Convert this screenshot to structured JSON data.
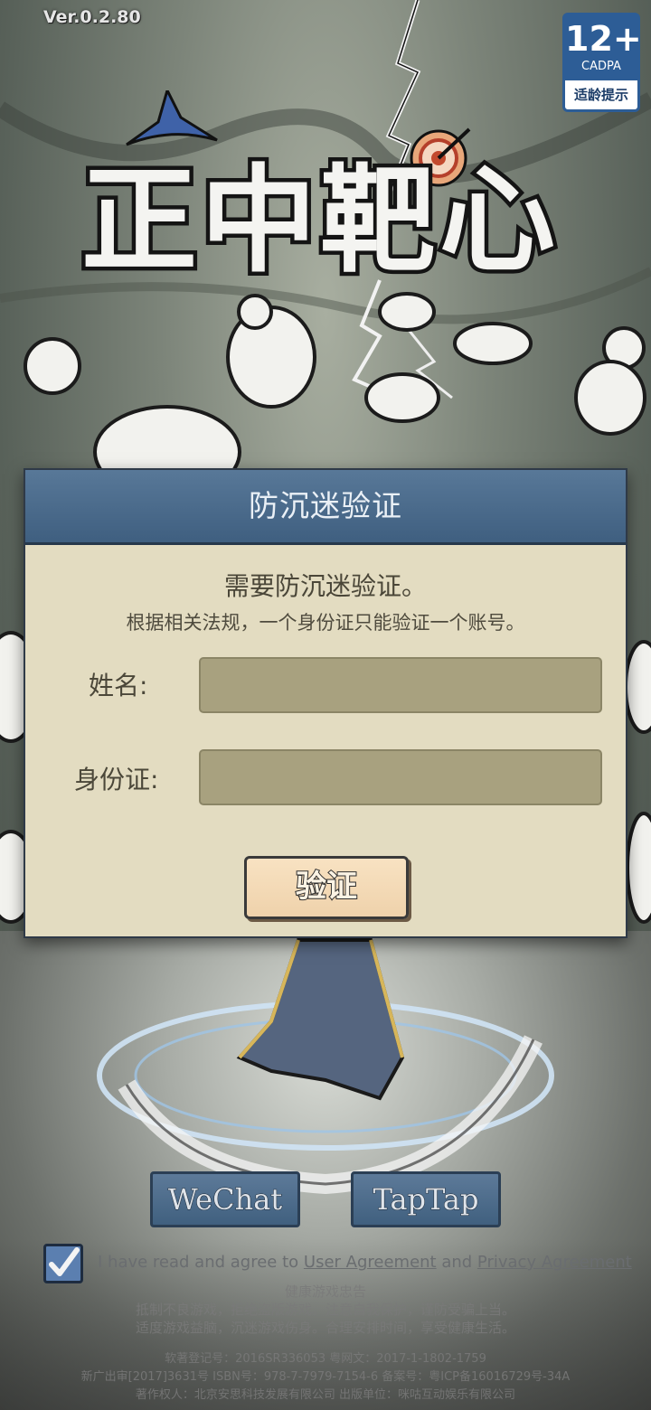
{
  "app": {
    "version": "Ver.0.2.80",
    "logo_text": "正中靶心"
  },
  "age_rating": {
    "number": "12+",
    "org": "CADPA",
    "label": "适龄提示"
  },
  "dialog": {
    "title": "防沉迷验证",
    "notice_title": "需要防沉迷验证。",
    "notice_subtitle": "根据相关法规，一个身份证只能验证一个账号。",
    "name_label": "姓名:",
    "name_value": "",
    "id_label": "身份证:",
    "id_value": "",
    "verify_button": "验证"
  },
  "login": {
    "wechat_label": "WeChat",
    "taptap_label": "TapTap"
  },
  "agreement": {
    "checked": true,
    "prefix": "I have read and agree to ",
    "link1": "User Agreement",
    "and": " and ",
    "link2": "Privacy Agreement"
  },
  "footer": {
    "health_title": "健康游戏忠告",
    "health_line1": "抵制不良游戏，拒绝盗版游戏。注意自我保护，谨防受骗上当。",
    "health_line2": "适度游戏益脑，沉迷游戏伤身。合理安排时间，享受健康生活。",
    "reg_line1": "软著登记号：2016SR336053 粤网文：2017-1-1802-1759",
    "reg_line2": "新广出审[2017]3631号 ISBN号：978-7-7979-7154-6 备案号：粤ICP备16016729号-34A",
    "reg_line3": "著作权人：北京安思科技发展有限公司 出版单位：咪咕互动娱乐有限公司"
  },
  "colors": {
    "dialog_header": "#4a6a8b",
    "dialog_body": "#e3dcc1",
    "input_bg": "#a8a17f",
    "verify_button_bg": "#f3d9b5",
    "login_button_bg": "#4d6d8e"
  }
}
